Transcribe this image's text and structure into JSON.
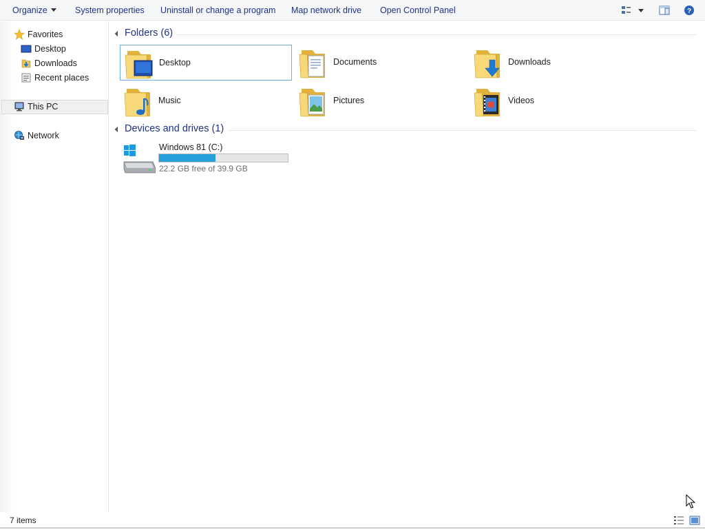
{
  "commandbar": {
    "organize": "Organize",
    "system_properties": "System properties",
    "uninstall": "Uninstall or change a program",
    "map_drive": "Map network drive",
    "control_panel": "Open Control Panel",
    "icons": [
      "view-options-icon",
      "dropdown-caret-icon",
      "preview-pane-icon",
      "help-icon"
    ]
  },
  "nav": {
    "favorites": "Favorites",
    "desktop": "Desktop",
    "downloads": "Downloads",
    "recent": "Recent places",
    "this_pc": "This PC",
    "network": "Network"
  },
  "content": {
    "folders_header": "Folders (6)",
    "folders": [
      {
        "label": "Desktop",
        "icon": "desktop-folder-icon"
      },
      {
        "label": "Documents",
        "icon": "documents-folder-icon"
      },
      {
        "label": "Downloads",
        "icon": "downloads-folder-icon"
      },
      {
        "label": "Music",
        "icon": "music-folder-icon"
      },
      {
        "label": "Pictures",
        "icon": "pictures-folder-icon"
      },
      {
        "label": "Videos",
        "icon": "videos-folder-icon"
      }
    ],
    "drives_header": "Devices and drives (1)",
    "drive": {
      "name": "Windows 81 (C:)",
      "free_text": "22.2 GB free of 39.9 GB",
      "used_fraction": 0.44
    }
  },
  "status": {
    "items": "7 items"
  },
  "colors": {
    "accent": "#1e3287",
    "selection_border": "#6eb0e6",
    "drive_fill": "#26a0da"
  }
}
